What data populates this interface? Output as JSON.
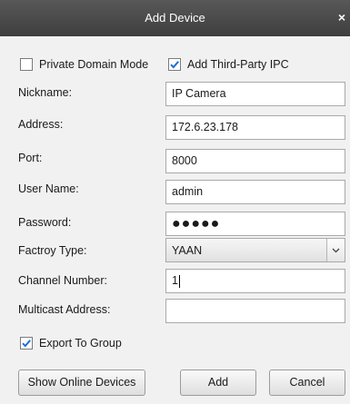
{
  "window": {
    "title": "Add Device",
    "close_glyph": "×"
  },
  "options": {
    "private_domain": {
      "label": "Private Domain Mode",
      "checked": false
    },
    "third_party": {
      "label": "Add Third-Party IPC",
      "checked": true
    }
  },
  "fields": {
    "nickname": {
      "label": "Nickname:",
      "value": "IP Camera"
    },
    "address": {
      "label": "Address:",
      "value": "172.6.23.178"
    },
    "port": {
      "label": "Port:",
      "value": "8000"
    },
    "username": {
      "label": "User Name:",
      "value": "admin"
    },
    "password": {
      "label": "Password:",
      "value": "●●●●●"
    },
    "factory_type": {
      "label": "Factroy Type:",
      "value": "YAAN"
    },
    "channel_number": {
      "label": "Channel Number:",
      "value": "1"
    },
    "multicast_address": {
      "label": "Multicast Address:",
      "value": ""
    }
  },
  "export_to_group": {
    "label": "Export To Group",
    "checked": true
  },
  "buttons": {
    "show_online": "Show Online Devices",
    "add": "Add",
    "cancel": "Cancel"
  },
  "colors": {
    "titlebar": "#4a4a4a",
    "background": "#f1f1f1",
    "check": "#1f6fd1"
  },
  "icons": {
    "checkmark": "checkmark-icon",
    "dropdown": "chevron-down-icon",
    "close": "close-icon"
  }
}
